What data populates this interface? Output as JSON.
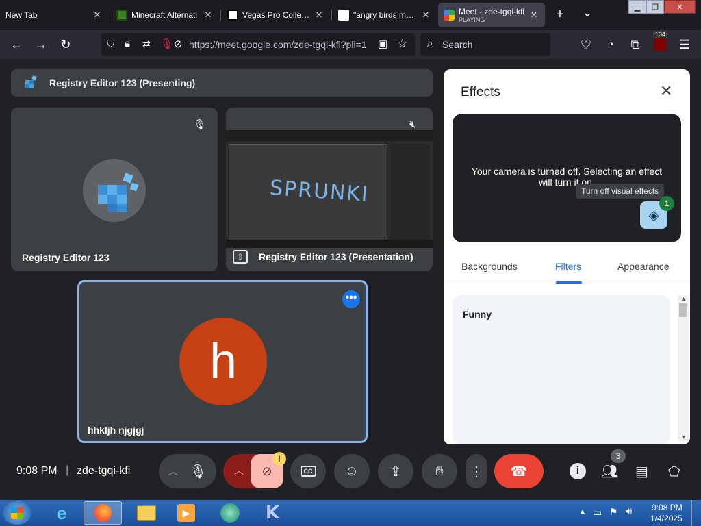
{
  "browser": {
    "tabs": [
      {
        "title": "New Tab"
      },
      {
        "title": "Minecraft Alternati"
      },
      {
        "title": "Vegas Pro Collectio"
      },
      {
        "title": "\"angry birds maker"
      },
      {
        "title": "Meet - zde-tgqi-kfi",
        "subtitle": "PLAYING"
      }
    ],
    "new_tab": "+",
    "tab_list": "⌄",
    "url": "https://meet.google.com/zde-tgqi-kfi?pli=1",
    "search_placeholder": "Search",
    "extension_badge": "134"
  },
  "meet": {
    "presenting_banner": "Registry Editor 123 (Presenting)",
    "tiles": {
      "participant1": "Registry Editor 123",
      "presentation": "Registry Editor 123 (Presentation)",
      "self_name": "hhkljh njgjgj",
      "self_initial": "h",
      "sprunki_text": "SPRUNKI"
    },
    "effects": {
      "title": "Effects",
      "camera_off_text": "Your camera is turned off. Selecting an effect will turn it on.",
      "tooltip": "Turn off visual effects",
      "effect_count": "1",
      "tabs": [
        "Backgrounds",
        "Filters",
        "Appearance"
      ],
      "active_tab": "Filters",
      "section_title": "Funny"
    },
    "bottom": {
      "time": "9:08 PM",
      "separator": "|",
      "meeting_code": "zde-tgqi-kfi",
      "warning_badge": "!",
      "people_count": "3"
    }
  },
  "taskbar": {
    "time": "9:08 PM",
    "date": "1/4/2025"
  },
  "colors": {
    "meet_bg": "#202124",
    "tile_bg": "#3c4043",
    "accent_blue": "#1a73e8",
    "end_call_red": "#ea4335",
    "avatar_orange": "#c73f14",
    "cam_off_pink": "#f9b8b0",
    "badge_green": "#188038"
  }
}
